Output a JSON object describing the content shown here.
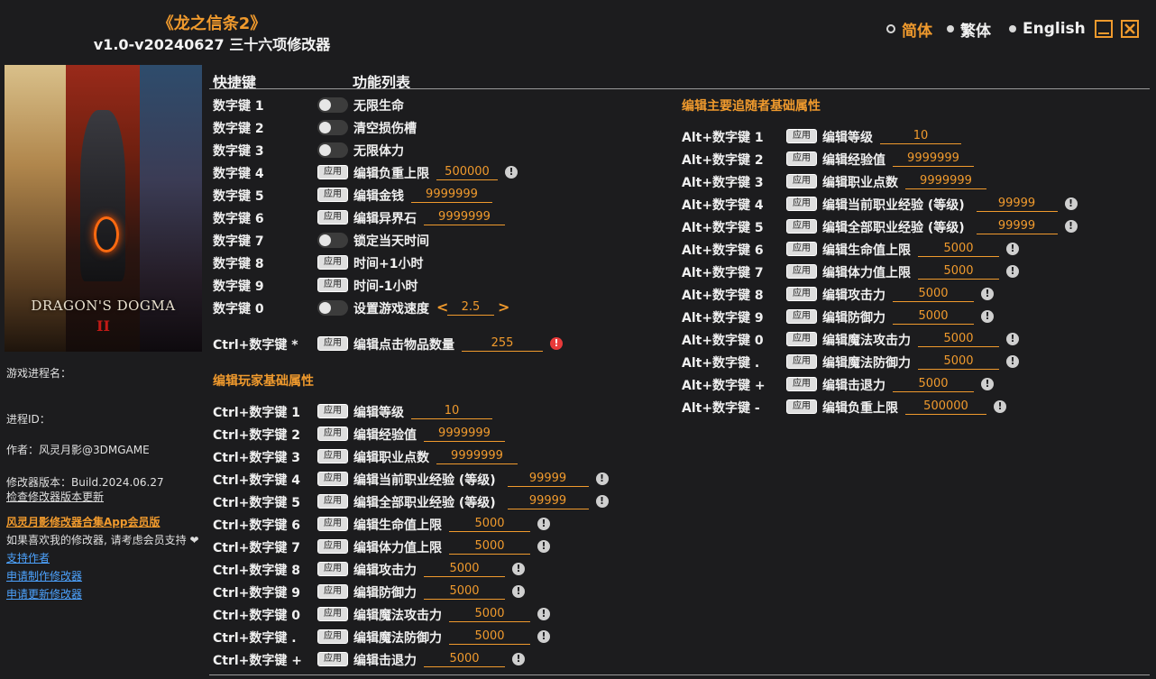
{
  "header": {
    "game_title": "《龙之信条2》",
    "subtitle": "v1.0-v20240627 三十六项修改器"
  },
  "languages": [
    {
      "label": "简体",
      "active": true
    },
    {
      "label": "繁体",
      "active": false
    },
    {
      "label": "English",
      "active": false
    }
  ],
  "window": {
    "minimize_icon": "minimize-icon",
    "close_icon": "close-icon"
  },
  "cover": {
    "logo_text": "DRAGON'S DOGMA",
    "logo_numeral": "II"
  },
  "sidebar": {
    "process_name_label": "游戏进程名：",
    "process_id_label": "进程ID：",
    "author": "作者：风灵月影@3DMGAME",
    "version": "修改器版本：Build.2024.06.27",
    "check_update": "检查修改器版本更新",
    "app_promo": "风灵月影修改器合集App会员版",
    "support_text": "如果喜欢我的修改器, 请考虑会员支持",
    "links": [
      "支持作者",
      "申请制作修改器",
      "申请更新修改器"
    ]
  },
  "columns": {
    "hotkey": "快捷键",
    "features": "功能列表"
  },
  "apply_label": "应用",
  "main_features": [
    {
      "key": "数字键 1",
      "label": "无限生命",
      "control": "toggle"
    },
    {
      "key": "数字键 2",
      "label": "清空损伤槽",
      "control": "toggle"
    },
    {
      "key": "数字键 3",
      "label": "无限体力",
      "control": "toggle"
    },
    {
      "key": "数字键 4",
      "label": "编辑负重上限",
      "control": "apply",
      "value": "500000",
      "warn": "!"
    },
    {
      "key": "数字键 5",
      "label": "编辑金钱",
      "control": "apply",
      "value": "9999999"
    },
    {
      "key": "数字键 6",
      "label": "编辑异界石",
      "control": "apply",
      "value": "9999999"
    },
    {
      "key": "数字键 7",
      "label": "锁定当天时间",
      "control": "toggle"
    },
    {
      "key": "数字键 8",
      "label": "时间+1小时",
      "control": "apply"
    },
    {
      "key": "数字键 9",
      "label": "时间-1小时",
      "control": "apply"
    },
    {
      "key": "数字键 0",
      "label": "设置游戏速度",
      "control": "toggle",
      "value": "2.5",
      "arrows": [
        "<",
        ">"
      ]
    }
  ],
  "item_feature": {
    "key": "Ctrl+数字键 *",
    "label": "编辑点击物品数量",
    "value": "255",
    "warn": "!"
  },
  "player_section": {
    "title": "编辑玩家基础属性",
    "rows": [
      {
        "key": "Ctrl+数字键 1",
        "label": "编辑等级",
        "value": "10"
      },
      {
        "key": "Ctrl+数字键 2",
        "label": "编辑经验值",
        "value": "9999999"
      },
      {
        "key": "Ctrl+数字键 3",
        "label": "编辑职业点数",
        "value": "9999999"
      },
      {
        "key": "Ctrl+数字键 4",
        "label": "编辑当前职业经验 (等级)",
        "value": "99999",
        "warn": "!"
      },
      {
        "key": "Ctrl+数字键 5",
        "label": "编辑全部职业经验 (等级)",
        "value": "99999",
        "warn": "!"
      },
      {
        "key": "Ctrl+数字键 6",
        "label": "编辑生命值上限",
        "value": "5000",
        "warn": "!"
      },
      {
        "key": "Ctrl+数字键 7",
        "label": "编辑体力值上限",
        "value": "5000",
        "warn": "!"
      },
      {
        "key": "Ctrl+数字键 8",
        "label": "编辑攻击力",
        "value": "5000",
        "warn": "!"
      },
      {
        "key": "Ctrl+数字键 9",
        "label": "编辑防御力",
        "value": "5000",
        "warn": "!"
      },
      {
        "key": "Ctrl+数字键 0",
        "label": "编辑魔法攻击力",
        "value": "5000",
        "warn": "!"
      },
      {
        "key": "Ctrl+数字键 .",
        "label": "编辑魔法防御力",
        "value": "5000",
        "warn": "!"
      },
      {
        "key": "Ctrl+数字键 +",
        "label": "编辑击退力",
        "value": "5000",
        "warn": "!"
      }
    ]
  },
  "pawn_section": {
    "title": "编辑主要追随者基础属性",
    "rows": [
      {
        "key": "Alt+数字键 1",
        "label": "编辑等级",
        "value": "10"
      },
      {
        "key": "Alt+数字键 2",
        "label": "编辑经验值",
        "value": "9999999"
      },
      {
        "key": "Alt+数字键 3",
        "label": "编辑职业点数",
        "value": "9999999"
      },
      {
        "key": "Alt+数字键 4",
        "label": "编辑当前职业经验 (等级)",
        "value": "99999",
        "warn": "!"
      },
      {
        "key": "Alt+数字键 5",
        "label": "编辑全部职业经验 (等级)",
        "value": "99999",
        "warn": "!"
      },
      {
        "key": "Alt+数字键 6",
        "label": "编辑生命值上限",
        "value": "5000",
        "warn": "!"
      },
      {
        "key": "Alt+数字键 7",
        "label": "编辑体力值上限",
        "value": "5000",
        "warn": "!"
      },
      {
        "key": "Alt+数字键 8",
        "label": "编辑攻击力",
        "value": "5000",
        "warn": "!"
      },
      {
        "key": "Alt+数字键 9",
        "label": "编辑防御力",
        "value": "5000",
        "warn": "!"
      },
      {
        "key": "Alt+数字键 0",
        "label": "编辑魔法攻击力",
        "value": "5000",
        "warn": "!"
      },
      {
        "key": "Alt+数字键 .",
        "label": "编辑魔法防御力",
        "value": "5000",
        "warn": "!"
      },
      {
        "key": "Alt+数字键 +",
        "label": "编辑击退力",
        "value": "5000",
        "warn": "!"
      },
      {
        "key": "Alt+数字键 -",
        "label": "编辑负重上限",
        "value": "500000",
        "warn": "!"
      }
    ]
  }
}
